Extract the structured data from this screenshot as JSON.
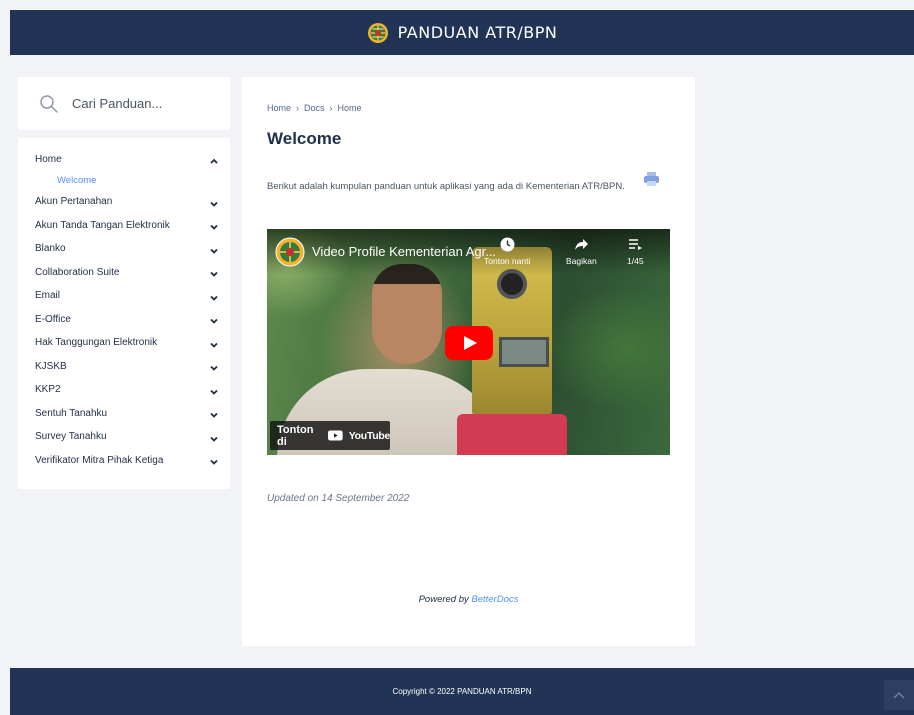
{
  "header": {
    "title": "PANDUAN ATR/BPN",
    "logo_icon": "atr-bpn-globe-logo"
  },
  "search": {
    "placeholder": "Cari Panduan..."
  },
  "sidebar": {
    "home": {
      "label": "Home",
      "expanded": true,
      "sub_items": [
        "Welcome"
      ]
    },
    "items": [
      "Akun Pertanahan",
      "Akun Tanda Tangan Elektronik",
      "Blanko",
      "Collaboration Suite",
      "Email",
      "E-Office",
      "Hak Tanggungan Elektronik",
      "KJSKB",
      "KKP2",
      "Sentuh Tanahku",
      "Survey Tanahku",
      "Verifikator Mitra Pihak Ketiga"
    ]
  },
  "breadcrumb": [
    "Home",
    "Docs",
    "Home"
  ],
  "page": {
    "title": "Welcome",
    "intro": "Berikut adalah kumpulan panduan untuk aplikasi yang ada di Kementerian ATR/BPN.",
    "updated": "Updated on 14 September 2022"
  },
  "video": {
    "title": "Video Profile Kementerian Agr...",
    "watch_later": "Tonton nanti",
    "share": "Bagikan",
    "playlist_count": "1/45",
    "watch_on": "Tonton di",
    "platform": "YouTube"
  },
  "powered": {
    "prefix": "Powered by",
    "link": "BetterDocs"
  },
  "footer": {
    "copyright": "Copyright © 2022 PANDUAN ATR/BPN"
  },
  "colors": {
    "navy": "#213455",
    "accent": "#528ffe",
    "background": "#f1f3f6"
  }
}
